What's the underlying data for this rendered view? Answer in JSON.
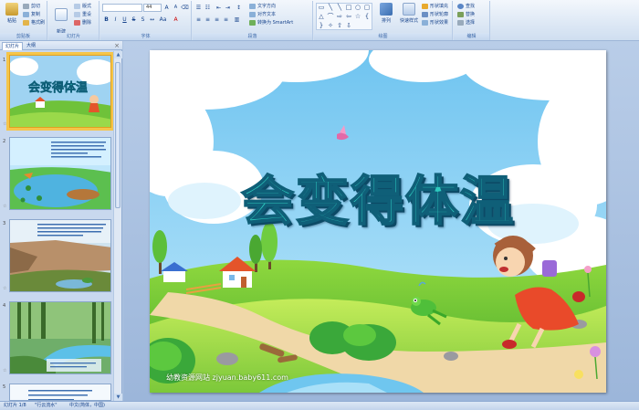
{
  "ribbon": {
    "clipboard": {
      "label": "剪贴板",
      "paste": "粘贴",
      "cut": "剪切",
      "copy": "复制",
      "format_painter": "格式刷"
    },
    "slides": {
      "label": "幻灯片",
      "new_slide": "新建\n幻灯片",
      "layout": "版式",
      "reset": "重设",
      "delete": "删除"
    },
    "font": {
      "label": "字体",
      "size": "44"
    },
    "paragraph": {
      "label": "段落",
      "text_direction": "文字方向",
      "align_text": "对齐文本",
      "convert_smartart": "转换为 SmartArt"
    },
    "drawing": {
      "label": "绘图",
      "arrange": "排列",
      "quick_styles": "快速样式",
      "shape_fill": "形状填充",
      "shape_outline": "形状轮廓",
      "shape_effects": "形状效果"
    },
    "editing": {
      "label": "编辑",
      "find": "查找",
      "replace": "替换",
      "select": "选择"
    }
  },
  "left_pane": {
    "tabs": [
      "幻灯片",
      "大纲"
    ],
    "close": "×",
    "slide_numbers": [
      "1",
      "2",
      "3",
      "4",
      "5"
    ],
    "thumb1_title": "会变得体温"
  },
  "slide": {
    "title": "会变得体温",
    "watermark": "幼教资源网站  zjyuan.baby611.com"
  },
  "status_bar": {
    "slide_info": "幻灯片 1/8",
    "theme": "\"行云流水\"",
    "language": "中文(简体，中国)"
  },
  "colors": {
    "title_fill": "#2ec9bf",
    "title_stroke": "#0f5f78",
    "ribbon_text": "#15428b"
  }
}
